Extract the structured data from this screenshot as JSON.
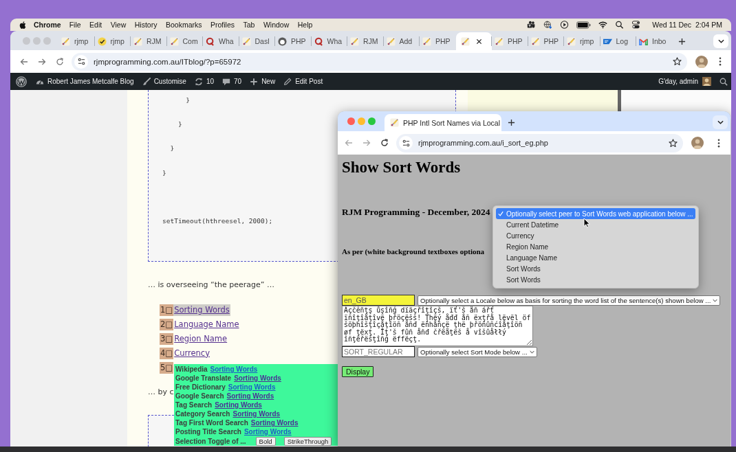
{
  "menu_bar": {
    "app": "Chrome",
    "menus": [
      "File",
      "Edit",
      "View",
      "History",
      "Bookmarks",
      "Profiles",
      "Tab",
      "Window",
      "Help"
    ],
    "clock": "Wed 11 Dec  2:04 PM"
  },
  "browser": {
    "tabs": [
      {
        "kind": "quill",
        "label": "rjmp",
        "selected": false
      },
      {
        "kind": "check",
        "label": "rjmp",
        "selected": false
      },
      {
        "kind": "quill",
        "label": "RJM",
        "selected": false
      },
      {
        "kind": "quill",
        "label": "Com",
        "selected": false
      },
      {
        "kind": "q",
        "label": "Wha",
        "selected": false
      },
      {
        "kind": "quill",
        "label": "Dasl",
        "selected": false
      },
      {
        "kind": "circle",
        "label": "PHP",
        "selected": false
      },
      {
        "kind": "q",
        "label": "Wha",
        "selected": false
      },
      {
        "kind": "quill",
        "label": "RJM",
        "selected": false
      },
      {
        "kind": "quill",
        "label": "Add",
        "selected": false
      },
      {
        "kind": "quill",
        "label": "PHP",
        "selected": false
      },
      {
        "kind": "quill",
        "selected": true
      },
      {
        "kind": "quill",
        "label": "PHP",
        "selected": false
      },
      {
        "kind": "quill",
        "label": "PHP",
        "selected": false
      },
      {
        "kind": "quill",
        "label": "rjmp",
        "selected": false
      },
      {
        "kind": "banner",
        "label": "Log",
        "selected": false
      },
      {
        "kind": "mail",
        "label": "Inbo",
        "selected": false
      }
    ],
    "address": "rjmprogramming.com.au/ITblog/?p=65972"
  },
  "admin_bar": {
    "site": "Robert James Metcalfe Blog",
    "items": [
      {
        "kind": "brush",
        "label": "Customise"
      },
      {
        "kind": "updates",
        "label": "10"
      },
      {
        "kind": "comments",
        "label": "70"
      },
      {
        "kind": "new",
        "label": "New"
      },
      {
        "kind": "edit",
        "label": "Edit Post"
      }
    ],
    "greeting": "G'day, admin"
  },
  "article": {
    "code_block": "      }\n\n    }\n\n  }\n\n}\n\n\n\nsetTimeout(hthreesel, 2000);",
    "intro": "… is overseeing “the peerage” …",
    "peers": [
      {
        "number": "1□",
        "label": "Sorting Words",
        "selected": true
      },
      {
        "number": "2□",
        "label": "Language Name",
        "selected": false
      },
      {
        "number": "3□",
        "label": "Region Name",
        "selected": false
      },
      {
        "number": "4□",
        "label": "Currency",
        "selected": false
      },
      {
        "number": "5□"
      }
    ],
    "after": "… by c"
  },
  "peer_popup": {
    "rows": [
      {
        "label": "Wikipedia",
        "link": "Sorting Words",
        "visited": false
      },
      {
        "label": "Google Translate",
        "link": "Sorting Words",
        "visited": true
      },
      {
        "label": "Free Dictionary",
        "link": "Sorting Words",
        "visited": false
      },
      {
        "label": "Google Search",
        "link": "Sorting Words",
        "visited": true
      },
      {
        "label": "Tag Search",
        "link": "Sorting Words",
        "visited": true
      },
      {
        "label": "Category Search",
        "link": "Sorting Words",
        "visited": true
      },
      {
        "label": "Tag First Word Search",
        "link": "Sorting Words",
        "visited": true
      },
      {
        "label": "Posting Title Search",
        "link": "Sorting Words",
        "visited": false
      }
    ],
    "toggle_label": "Selection Toggle of ...",
    "toggle_buttons": [
      "Bold",
      "StrikeThrough"
    ]
  },
  "popup_window": {
    "tab": "PHP Intl Sort Names via Local",
    "address": "rjmprogramming.com.au/i_sort_eg.php",
    "heading": "Show Sort Words",
    "subheading": "RJM Programming - December, 2024",
    "note": "As per (white background textboxes optiona",
    "locale": {
      "value": "en_GB"
    },
    "locale_select": "Optionally select a Locale below as basis for sorting the word list of the sentence(s) shown below ...",
    "sentence": "Áçčêñţş ůşîñģ dïäçřîţîçš, ïť'š åñ ářť ïñîţîåţîvë þřöçëšš! Ţhëý åđđ åñ ëxţřå lëvël öf šöþhîšţîçåţîöñ åñđ ëñhåñçë ţhë þřöñûñćîåţîöñ øf ţëxţ. Îţ'š fûñ åñđ čřëåţëš å vîšûåłłý îñţëřëšţîñģ ëffëçţ.",
    "sort_mode": {
      "placeholder": "SORT_REGULAR"
    },
    "sort_select": "Optionally select Sort Mode below ...",
    "display_button": "Display",
    "peer_menu": [
      {
        "label": "Optionally select peer to Sort Words web application below ...",
        "selected": true
      },
      {
        "label": "Current Datetime",
        "selected": false
      },
      {
        "label": "Currency",
        "selected": false
      },
      {
        "label": "Region Name",
        "selected": false
      },
      {
        "label": "Language Name",
        "selected": false
      },
      {
        "label": "Sort Words",
        "selected": false
      },
      {
        "label": "Sort Words",
        "selected": false
      }
    ]
  }
}
